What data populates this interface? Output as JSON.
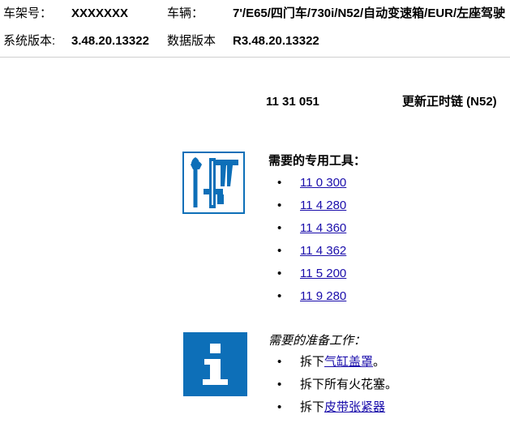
{
  "header": {
    "vin_label": "车架号：",
    "vin_value": "XXXXXXX",
    "vehicle_label": "车辆：",
    "vehicle_value": "7'/E65/四门车/730i/N52/自动变速箱/EUR/左座驾驶",
    "system_version_label": "系统版本:",
    "system_version_value": "3.48.20.13322",
    "data_version_label": "数据版本",
    "data_version_value": "R3.48.20.13322"
  },
  "document": {
    "code": "11 31 051",
    "title": "更新正时链 (N52)"
  },
  "tools_section": {
    "icon": "tools-icon",
    "title": "需要的专用工具：",
    "items": [
      "11 0 300",
      "11 4 280",
      "11 4 360",
      "11 4 362",
      "11 5 200",
      "11 9 280"
    ]
  },
  "prep_section": {
    "icon": "info-icon",
    "title": "需要的准备工作：",
    "items": [
      {
        "prefix": "拆下",
        "link": "气缸盖罩",
        "suffix": "。"
      },
      {
        "prefix": "拆下所有火花塞。",
        "link": "",
        "suffix": ""
      },
      {
        "prefix": "拆下",
        "link": "皮带张紧器",
        "suffix": ""
      }
    ]
  },
  "colors": {
    "brand_blue": "#0d6fb8",
    "link": "#1a0dab"
  }
}
